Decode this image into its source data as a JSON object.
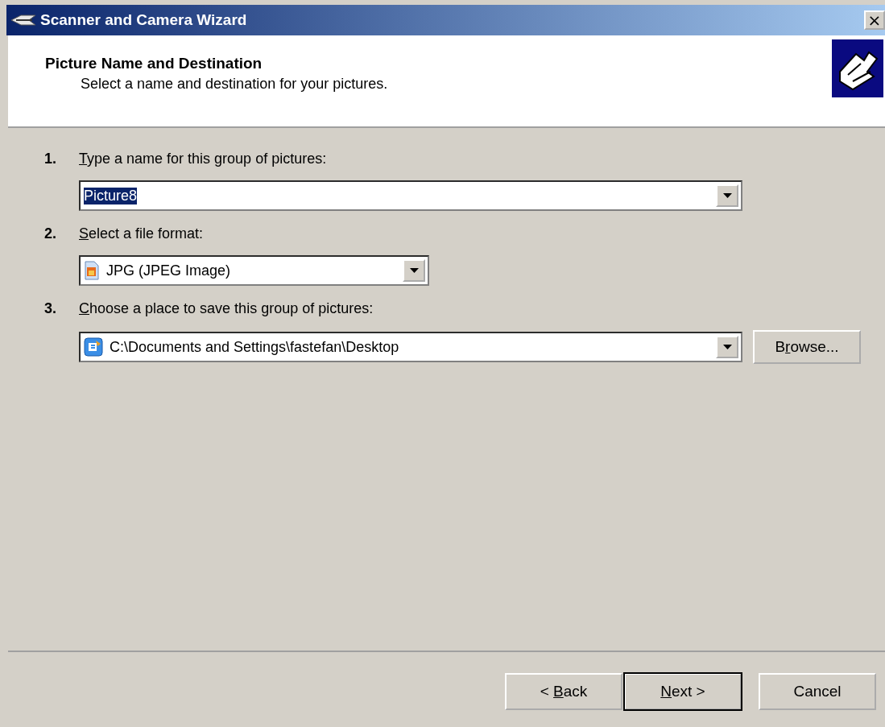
{
  "window": {
    "title": "Scanner and Camera Wizard",
    "close": "×"
  },
  "header": {
    "title": "Picture Name and Destination",
    "subtitle": "Select a name and destination for your pictures."
  },
  "steps": [
    {
      "number": "1.",
      "label": {
        "key": "T",
        "after": "ype a name for this group of pictures:"
      },
      "field": {
        "kind": "text",
        "value": "Picture8",
        "selected": true
      }
    },
    {
      "number": "2.",
      "label": {
        "key": "S",
        "after": "elect a file format:"
      },
      "field": {
        "kind": "format",
        "value": "JPG (JPEG Image)",
        "selected": false
      }
    },
    {
      "number": "3.",
      "label": {
        "key": "C",
        "after": "hoose a place to save this group of pictures:"
      },
      "field": {
        "kind": "folder",
        "value": "C:\\Documents and Settings\\fastefan\\Desktop",
        "selected": false
      },
      "button": {
        "before": "B",
        "key": "r",
        "after": "owse..."
      }
    }
  ],
  "buttons": [
    {
      "before": "< ",
      "key": "B",
      "after": "ack",
      "default": false
    },
    {
      "key": "N",
      "after": "ext >",
      "default": true
    },
    {
      "before": "Cancel",
      "default": false
    }
  ]
}
